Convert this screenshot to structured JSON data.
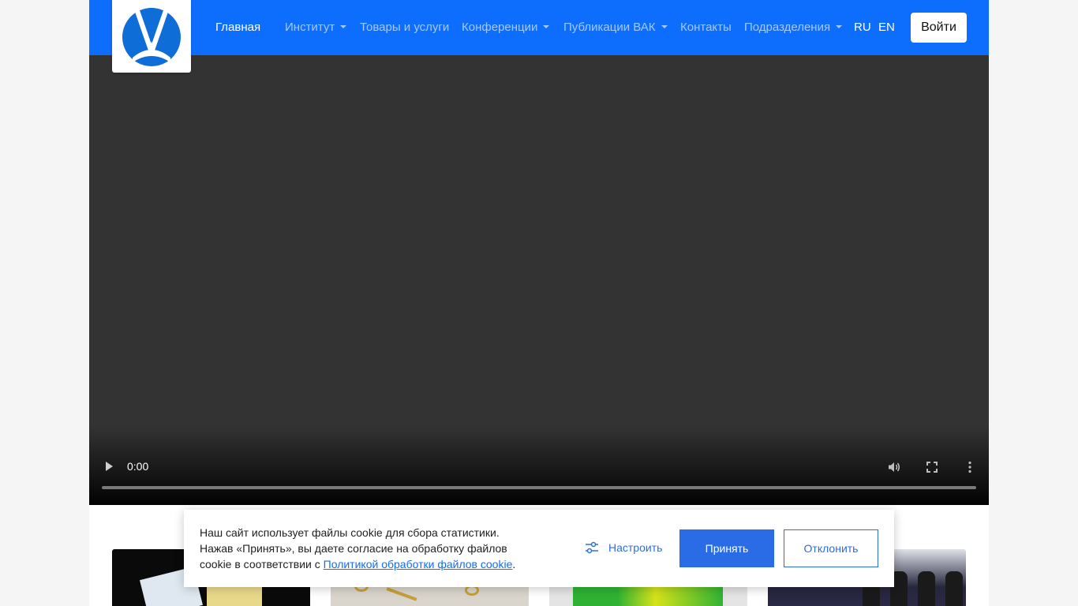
{
  "nav": {
    "items": [
      {
        "label": "Главная",
        "active": true,
        "dropdown": false
      },
      {
        "label": "Институт",
        "active": false,
        "dropdown": true
      },
      {
        "label": "Товары и услуги",
        "active": false,
        "dropdown": false
      },
      {
        "label": "Конференции",
        "active": false,
        "dropdown": true
      },
      {
        "label": "Публикации ВАК",
        "active": false,
        "dropdown": true
      },
      {
        "label": "Контакты",
        "active": false,
        "dropdown": false
      },
      {
        "label": "Подразделения",
        "active": false,
        "dropdown": true
      }
    ],
    "lang_ru": "RU",
    "lang_en": "EN",
    "login_label": "Войти",
    "bg_color": "#0d6efd"
  },
  "video": {
    "time": "0:00",
    "progress": 0
  },
  "cookie": {
    "line1": "Наш сайт использует файлы cookie для сбора статистики.",
    "line2": "Нажав «Принять», вы даете согласие на обработку файлов",
    "line3_prefix": "cookie в соответствии с ",
    "policy_link": "Политикой обработки файлов cookie",
    "line3_suffix": ".",
    "configure_label": "Настроить",
    "accept_label": "Принять",
    "decline_label": "Отклонить",
    "accent_color": "#2a6be6"
  }
}
